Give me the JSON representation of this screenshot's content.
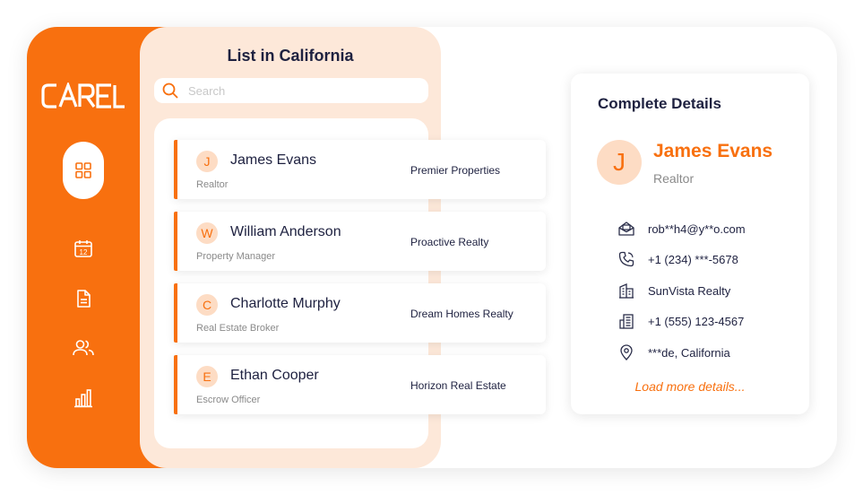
{
  "brand": {
    "name": "CAREL",
    "accent": "#F8700F"
  },
  "nav": [
    {
      "icon": "grid-icon",
      "active": true
    },
    {
      "icon": "calendar-icon",
      "label": "12"
    },
    {
      "icon": "document-icon"
    },
    {
      "icon": "users-icon"
    },
    {
      "icon": "bar-chart-icon"
    }
  ],
  "list": {
    "title": "List in California",
    "search_placeholder": "Search",
    "items": [
      {
        "initial": "J",
        "name": "James Evans",
        "role": "Realtor",
        "company": "Premier Properties"
      },
      {
        "initial": "W",
        "name": "William Anderson",
        "role": "Property Manager",
        "company": "Proactive Realty"
      },
      {
        "initial": "C",
        "name": "Charlotte Murphy",
        "role": "Real Estate Broker",
        "company": "Dream Homes Realty"
      },
      {
        "initial": "E",
        "name": "Ethan Cooper",
        "role": "Escrow Officer",
        "company": "Horizon Real Estate"
      }
    ]
  },
  "details": {
    "title": "Complete Details",
    "initial": "J",
    "name": "James Evans",
    "role": "Realtor",
    "email": "rob**h4@y**o.com",
    "phone": "+1 (234) ***-5678",
    "company": "SunVista Realty",
    "office_phone": "+1 (555) 123-4567",
    "location": "***de, California",
    "load_more": "Load more details..."
  }
}
